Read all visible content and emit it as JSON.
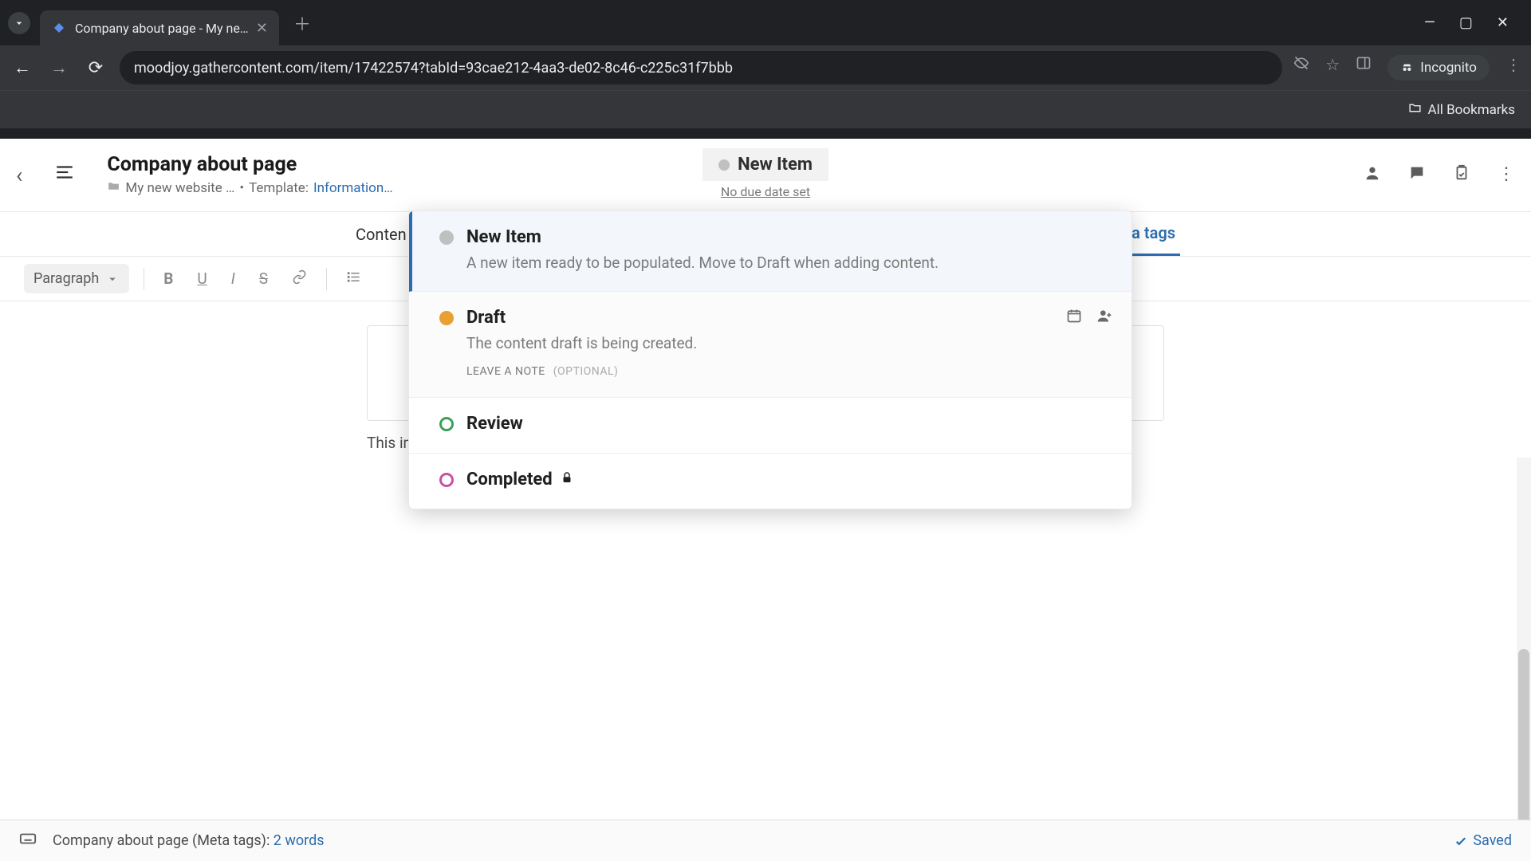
{
  "browser": {
    "tab_title": "Company about page - My ne…",
    "url": "moodjoy.gathercontent.com/item/17422574?tabId=93cae212-4aa3-de02-8c46-c225c31f7bbb",
    "incognito_label": "Incognito",
    "all_bookmarks": "All Bookmarks"
  },
  "header": {
    "title": "Company about page",
    "breadcrumb_folder": "My new website …",
    "template_prefix": "Template:",
    "template_link": "Information…",
    "status_label": "New Item",
    "due_date": "No due date set"
  },
  "tabs": {
    "left": "Conten",
    "right": "eta tags"
  },
  "toolbar": {
    "paragraph": "Paragraph"
  },
  "content": {
    "help_text": "This image will appear when someone posted it on Facebook."
  },
  "statuses": [
    {
      "name": "New Item",
      "desc": "A new item ready to be populated. Move to Draft when adding content.",
      "circle": "grey",
      "current": true
    },
    {
      "name": "Draft",
      "desc": "The content draft is being created.",
      "circle": "orange-fill",
      "hover": true,
      "note_label": "LEAVE A NOTE",
      "note_optional": "(OPTIONAL)"
    },
    {
      "name": "Review",
      "circle": "green"
    },
    {
      "name": "Completed",
      "circle": "purple",
      "locked": true
    }
  ],
  "footer": {
    "context": "Company about page (Meta tags):",
    "word_count": "2 words",
    "saved": "Saved"
  }
}
